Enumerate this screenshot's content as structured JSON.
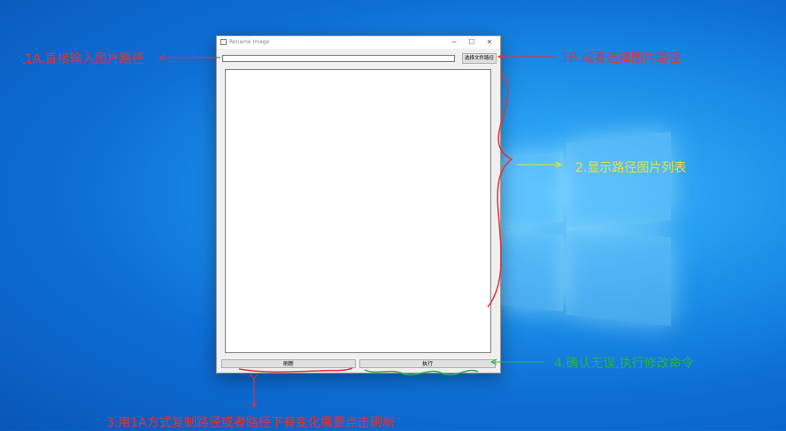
{
  "window": {
    "title": "Rename Image",
    "minimize_glyph": "─",
    "maximize_glyph": "☐",
    "close_glyph": "✕"
  },
  "path_input": {
    "value": "",
    "placeholder": ""
  },
  "choose_button": {
    "label": "选择文件路径"
  },
  "refresh_button": {
    "label": "刷新"
  },
  "execute_button": {
    "label": "执行"
  },
  "annotations": {
    "a1": "1A.直接输入图片路径",
    "b1": "1B.或者选择图片路径",
    "a2": "2.显示路径图片列表",
    "a3": "3.用1A方式复制路径或者路径下有变化需要点击刷新",
    "a4": "4.确认无误,执行修改命令"
  },
  "colors": {
    "red": "#e8303a",
    "yellow": "#e8e23a",
    "green": "#2cb04a"
  },
  "icons": [
    "app-icon",
    "minimize-icon",
    "maximize-icon",
    "close-icon"
  ]
}
